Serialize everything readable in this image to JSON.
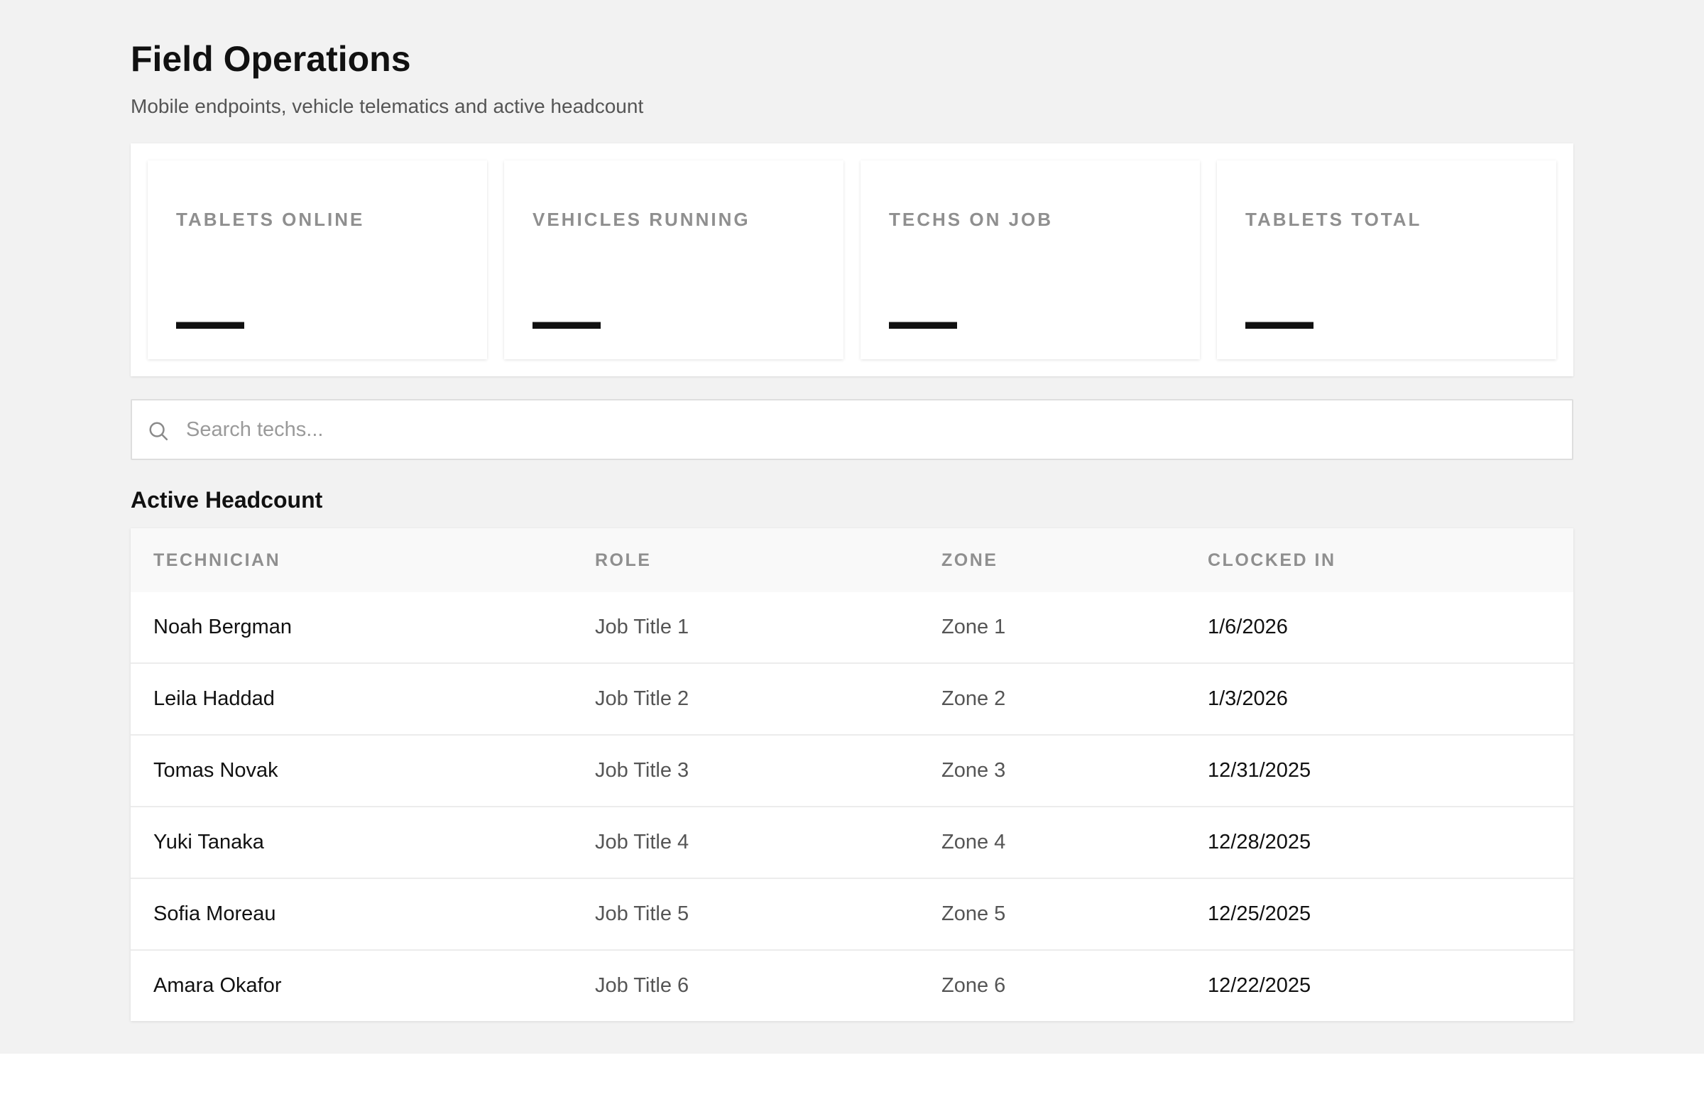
{
  "header": {
    "title": "Field Operations",
    "subtitle": "Mobile endpoints, vehicle telematics and active headcount"
  },
  "stats": [
    {
      "label": "TABLETS ONLINE",
      "value": "—"
    },
    {
      "label": "VEHICLES RUNNING",
      "value": "—"
    },
    {
      "label": "TECHS ON JOB",
      "value": "—"
    },
    {
      "label": "TABLETS TOTAL",
      "value": "—"
    }
  ],
  "search": {
    "placeholder": "Search techs...",
    "value": "",
    "icon": "search-icon"
  },
  "headcount": {
    "title": "Active Headcount",
    "columns": [
      "TECHNICIAN",
      "ROLE",
      "ZONE",
      "CLOCKED IN"
    ],
    "rows": [
      {
        "technician": "Noah Bergman",
        "role": "Job Title 1",
        "zone": "Zone 1",
        "clocked_in": "1/6/2026"
      },
      {
        "technician": "Leila Haddad",
        "role": "Job Title 2",
        "zone": "Zone 2",
        "clocked_in": "1/3/2026"
      },
      {
        "technician": "Tomas Novak",
        "role": "Job Title 3",
        "zone": "Zone 3",
        "clocked_in": "12/31/2025"
      },
      {
        "technician": "Yuki Tanaka",
        "role": "Job Title 4",
        "zone": "Zone 4",
        "clocked_in": "12/28/2025"
      },
      {
        "technician": "Sofia Moreau",
        "role": "Job Title 5",
        "zone": "Zone 5",
        "clocked_in": "12/25/2025"
      },
      {
        "technician": "Amara Okafor",
        "role": "Job Title 6",
        "zone": "Zone 6",
        "clocked_in": "12/22/2025"
      }
    ]
  },
  "colors": {
    "page_background": "#f2f2f2",
    "card_background": "#ffffff",
    "muted_label": "#8f8f8f",
    "primary_text": "#111111",
    "secondary_text": "#555555"
  }
}
